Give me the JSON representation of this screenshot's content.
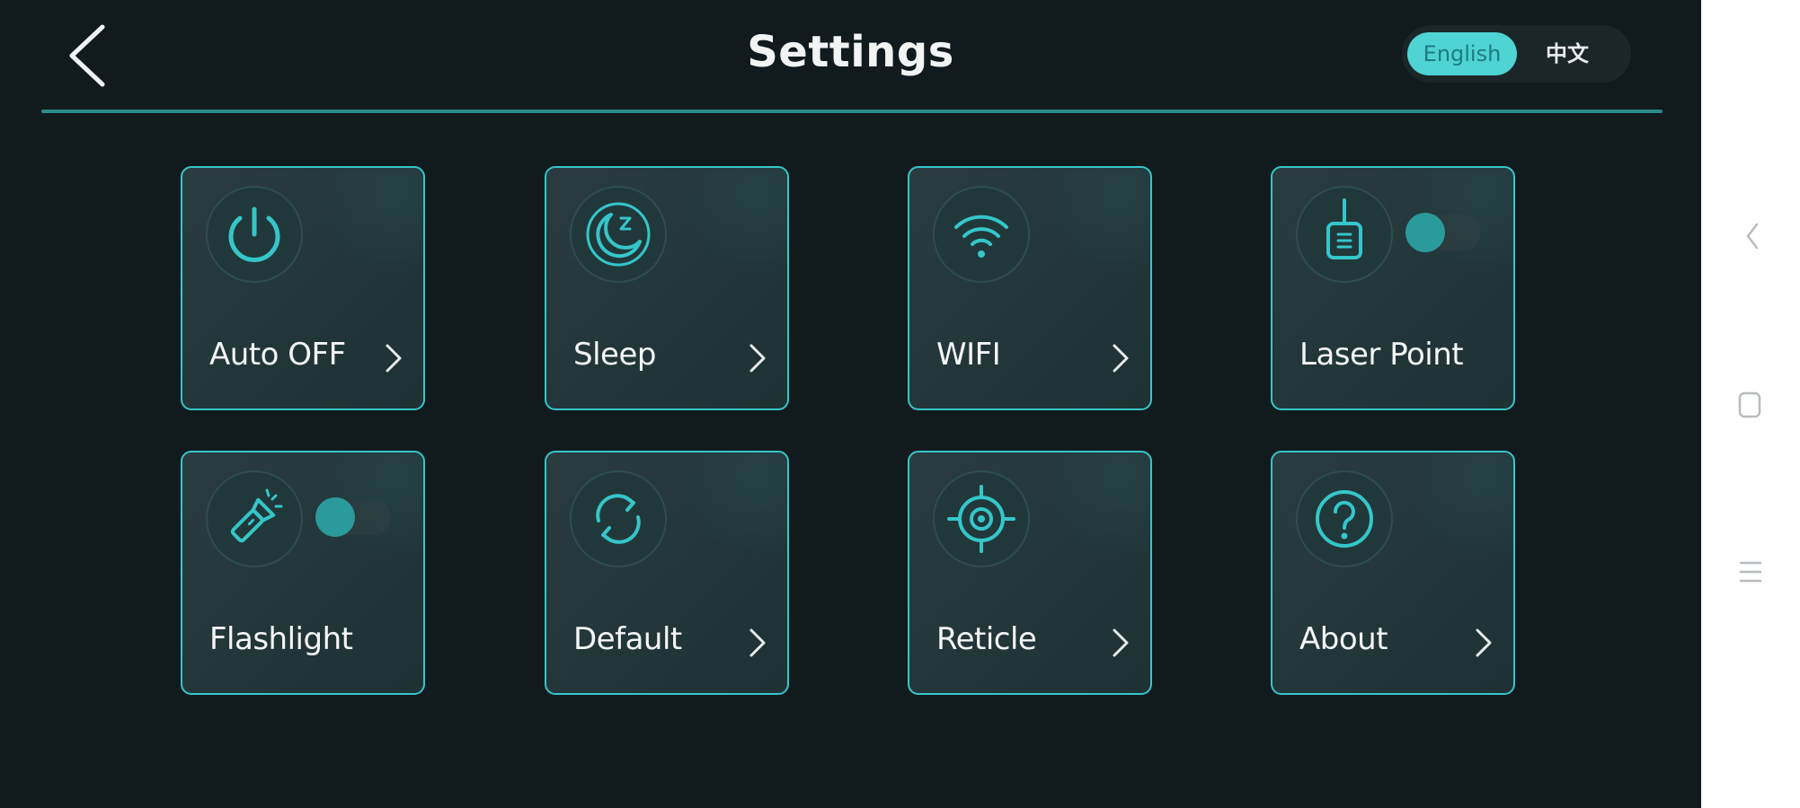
{
  "header": {
    "back_icon": "chevron-left-icon",
    "title": "Settings",
    "language": {
      "options": [
        "English",
        "中文"
      ],
      "selected": "English"
    }
  },
  "tiles": [
    {
      "label": "Auto OFF",
      "icon": "power-icon",
      "has_chevron": true
    },
    {
      "label": "Sleep",
      "icon": "sleep-moon-icon",
      "has_chevron": true
    },
    {
      "label": "WIFI",
      "icon": "wifi-icon",
      "has_chevron": true
    },
    {
      "label": "Laser Point",
      "icon": "laser-icon",
      "toggle": false
    },
    {
      "label": "Flashlight",
      "icon": "flashlight-icon",
      "toggle": false
    },
    {
      "label": "Default",
      "icon": "reset-icon",
      "has_chevron": true
    },
    {
      "label": "Reticle",
      "icon": "reticle-icon",
      "has_chevron": true
    },
    {
      "label": "About",
      "icon": "help-icon",
      "has_chevron": true
    }
  ],
  "system_nav": {
    "icons": [
      "nav-back-icon",
      "nav-home-icon",
      "nav-menu-icon"
    ]
  },
  "colors": {
    "background": "#111a1d",
    "accent": "#35c6c9",
    "lang_selected_bg": "#4fd3d3"
  }
}
